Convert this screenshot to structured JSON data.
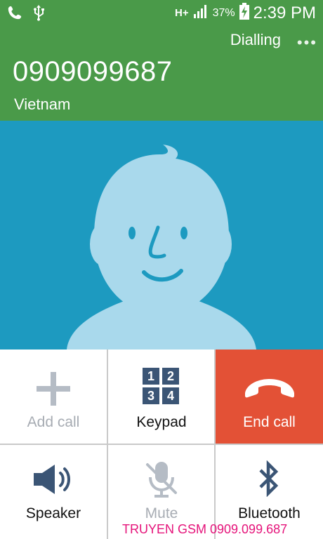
{
  "status_bar": {
    "icons_left": [
      "phone-call-icon",
      "usb-icon"
    ],
    "icons_right": [
      "network-type-icon",
      "signal-icon",
      "battery-charging-icon"
    ],
    "network_type": "H+",
    "battery_pct": "37%",
    "time": "2:39 PM"
  },
  "call": {
    "state": "Dialling",
    "more": "•••",
    "number": "0909099687",
    "location": "Vietnam"
  },
  "controls": {
    "add_call": "Add call",
    "keypad": "Keypad",
    "keypad_digits": [
      "1",
      "2",
      "3",
      "4"
    ],
    "end_call": "End call",
    "speaker": "Speaker",
    "mute": "Mute",
    "bluetooth": "Bluetooth"
  },
  "watermark": "TRUYEN GSM 0909.099.687",
  "colors": {
    "header_green": "#4a9a49",
    "photo_blue": "#1d9ac0",
    "avatar": "#a9d9ec",
    "end_call_red": "#e35136",
    "icon_dark": "#3b5575",
    "icon_disabled": "#b5bcc5"
  }
}
